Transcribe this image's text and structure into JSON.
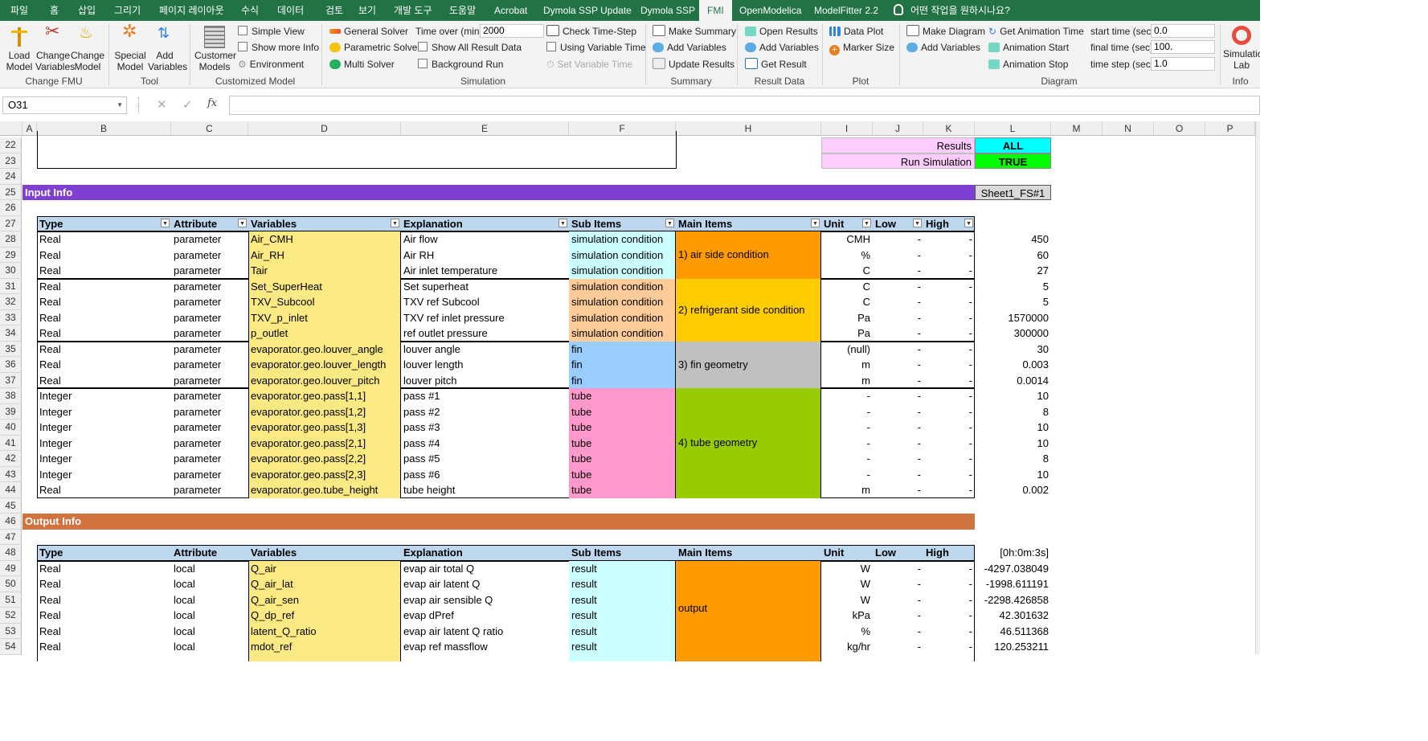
{
  "tabs": [
    "파일",
    "홈",
    "삽입",
    "그리기",
    "페이지 레이아웃",
    "수식",
    "데이터",
    "검토",
    "보기",
    "개발 도구",
    "도움말",
    "Acrobat",
    "Dymola SSP Update",
    "Dymola SSP",
    "FMI",
    "OpenModelica",
    "ModelFitter 2.2"
  ],
  "tell_me": "어떤 작업을 원하시나요?",
  "ribbon": {
    "change_fmu": {
      "load": "Load\nModel",
      "change_vars": "Change\nVariables",
      "change_model": "Change\nModel",
      "group": "Change FMU"
    },
    "tool": {
      "special": "Special\nModel",
      "add_vars": "Add\nVariables",
      "group": "Tool"
    },
    "customized": {
      "customer": "Customer\nModels",
      "simple_view": "Simple View",
      "show_more": "Show more Info",
      "environment": "Environment",
      "group": "Customized Model"
    },
    "simulation": {
      "general": "General Solver",
      "parametric": "Parametric Solver",
      "multi": "Multi Solver",
      "time_over_label": "Time over (min)",
      "time_over_value": "2000",
      "show_all": "Show All Result Data",
      "background": "Background Run",
      "check_time": "Check Time-Step",
      "using_var_time": "Using Variable Time",
      "set_var_time": "Set Variable Time",
      "group": "Simulation"
    },
    "summary": {
      "make": "Make Summary",
      "add_vars": "Add Variables",
      "update": "Update Results",
      "group": "Summary"
    },
    "result_data": {
      "open": "Open Results",
      "add_vars": "Add Variables",
      "get": "Get Result",
      "group": "Result Data"
    },
    "plot": {
      "data_plot": "Data Plot",
      "marker_size": "Marker Size",
      "group": "Plot"
    },
    "diagram": {
      "make": "Make Diagram",
      "add_vars": "Add Variables",
      "get_anim": "Get Animation Time",
      "anim_start": "Animation Start",
      "anim_stop": "Animation Stop",
      "start_label": "start time (sec)",
      "start_value": "0.0",
      "final_label": "final time (sec)",
      "final_value": "100.",
      "step_label": "time step (sec)",
      "step_value": "1.0",
      "group": "Diagram"
    },
    "info": {
      "simlab": "Simulation\nLab",
      "group": "Info"
    }
  },
  "formula": {
    "name_box": "O31",
    "value": ""
  },
  "columns": [
    "A",
    "B",
    "C",
    "D",
    "E",
    "F",
    "H",
    "I",
    "J",
    "K",
    "L",
    "M",
    "N",
    "O",
    "P"
  ],
  "rows": [
    "22",
    "23",
    "24",
    "25",
    "26",
    "27",
    "28",
    "29",
    "30",
    "31",
    "32",
    "33",
    "34",
    "35",
    "36",
    "37",
    "38",
    "39",
    "40",
    "41",
    "42",
    "43",
    "44",
    "45",
    "46",
    "47",
    "48",
    "49",
    "50",
    "51",
    "52",
    "53",
    "54"
  ],
  "status": {
    "results_label": "Results",
    "results_value": "ALL",
    "run_label": "Run Simulation",
    "run_value": "TRUE"
  },
  "input": {
    "section": "Input Info",
    "sheet_ref": "Sheet1_FS#1",
    "headers": [
      "Type",
      "Attribute",
      "Variables",
      "Explanation",
      "Sub Items",
      "Main Items",
      "Unit",
      "Low",
      "High"
    ],
    "rows": [
      {
        "type": "Real",
        "attr": "parameter",
        "var": "Air_CMH",
        "exp": "Air flow",
        "sub": "simulation condition",
        "unit": "CMH",
        "low": "-",
        "high": "-",
        "val": "450"
      },
      {
        "type": "Real",
        "attr": "parameter",
        "var": "Air_RH",
        "exp": "Air RH",
        "sub": "simulation condition",
        "unit": "%",
        "low": "-",
        "high": "-",
        "val": "60"
      },
      {
        "type": "Real",
        "attr": "parameter",
        "var": "Tair",
        "exp": "Air inlet temperature",
        "sub": "simulation condition",
        "unit": "C",
        "low": "-",
        "high": "-",
        "val": "27"
      },
      {
        "type": "Real",
        "attr": "parameter",
        "var": "Set_SuperHeat",
        "exp": "Set superheat",
        "sub": "simulation condition",
        "unit": "C",
        "low": "-",
        "high": "-",
        "val": "5"
      },
      {
        "type": "Real",
        "attr": "parameter",
        "var": "TXV_Subcool",
        "exp": "TXV ref Subcool",
        "sub": "simulation condition",
        "unit": "C",
        "low": "-",
        "high": "-",
        "val": "5"
      },
      {
        "type": "Real",
        "attr": "parameter",
        "var": "TXV_p_inlet",
        "exp": "TXV ref inlet pressure",
        "sub": "simulation condition",
        "unit": "Pa",
        "low": "-",
        "high": "-",
        "val": "1570000"
      },
      {
        "type": "Real",
        "attr": "parameter",
        "var": "p_outlet",
        "exp": "ref outlet pressure",
        "sub": "simulation condition",
        "unit": "Pa",
        "low": "-",
        "high": "-",
        "val": "300000"
      },
      {
        "type": "Real",
        "attr": "parameter",
        "var": "evaporator.geo.louver_angle",
        "exp": "louver angle",
        "sub": "fin",
        "unit": "(null)",
        "low": "-",
        "high": "-",
        "val": "30"
      },
      {
        "type": "Real",
        "attr": "parameter",
        "var": "evaporator.geo.louver_length",
        "exp": "louver length",
        "sub": "fin",
        "unit": "m",
        "low": "-",
        "high": "-",
        "val": "0.003"
      },
      {
        "type": "Real",
        "attr": "parameter",
        "var": "evaporator.geo.louver_pitch",
        "exp": "louver pitch",
        "sub": "fin",
        "unit": "m",
        "low": "-",
        "high": "-",
        "val": "0.0014"
      },
      {
        "type": "Integer",
        "attr": "parameter",
        "var": "evaporator.geo.pass[1,1]",
        "exp": "pass #1",
        "sub": "tube",
        "unit": "-",
        "low": "-",
        "high": "-",
        "val": "10"
      },
      {
        "type": "Integer",
        "attr": "parameter",
        "var": "evaporator.geo.pass[1,2]",
        "exp": "pass #2",
        "sub": "tube",
        "unit": "-",
        "low": "-",
        "high": "-",
        "val": "8"
      },
      {
        "type": "Integer",
        "attr": "parameter",
        "var": "evaporator.geo.pass[1,3]",
        "exp": "pass #3",
        "sub": "tube",
        "unit": "-",
        "low": "-",
        "high": "-",
        "val": "10"
      },
      {
        "type": "Integer",
        "attr": "parameter",
        "var": "evaporator.geo.pass[2,1]",
        "exp": "pass #4",
        "sub": "tube",
        "unit": "-",
        "low": "-",
        "high": "-",
        "val": "10"
      },
      {
        "type": "Integer",
        "attr": "parameter",
        "var": "evaporator.geo.pass[2,2]",
        "exp": "pass #5",
        "sub": "tube",
        "unit": "-",
        "low": "-",
        "high": "-",
        "val": "8"
      },
      {
        "type": "Integer",
        "attr": "parameter",
        "var": "evaporator.geo.pass[2,3]",
        "exp": "pass #6",
        "sub": "tube",
        "unit": "-",
        "low": "-",
        "high": "-",
        "val": "10"
      },
      {
        "type": "Real",
        "attr": "parameter",
        "var": "evaporator.geo.tube_height",
        "exp": "tube height",
        "sub": "tube",
        "unit": "m",
        "low": "-",
        "high": "-",
        "val": "0.002"
      }
    ],
    "groups": [
      {
        "label": "1) air side condition",
        "color": "#ff9a00",
        "sub_color": "#ccffff"
      },
      {
        "label": "2) refrigerant side condition",
        "color": "#ffcc00",
        "sub_color": "#ffcc99"
      },
      {
        "label": "3) fin geometry",
        "color": "#c0c0c0",
        "sub_color": "#99ccff"
      },
      {
        "label": "4) tube geometry",
        "color": "#99cc00",
        "sub_color": "#ff99cc"
      }
    ]
  },
  "output": {
    "section": "Output Info",
    "headers": [
      "Type",
      "Attribute",
      "Variables",
      "Explanation",
      "Sub Items",
      "Main Items",
      "Unit",
      "Low",
      "High"
    ],
    "time_header": "[0h:0m:3s]",
    "main_label": "output",
    "rows": [
      {
        "type": "Real",
        "attr": "local",
        "var": "Q_air",
        "exp": "evap air total Q",
        "sub": "result",
        "unit": "W",
        "low": "-",
        "high": "-",
        "val": "-4297.038049"
      },
      {
        "type": "Real",
        "attr": "local",
        "var": "Q_air_lat",
        "exp": "evap air latent Q",
        "sub": "result",
        "unit": "W",
        "low": "-",
        "high": "-",
        "val": "-1998.611191"
      },
      {
        "type": "Real",
        "attr": "local",
        "var": "Q_air_sen",
        "exp": "evap air sensible Q",
        "sub": "result",
        "unit": "W",
        "low": "-",
        "high": "-",
        "val": "-2298.426858"
      },
      {
        "type": "Real",
        "attr": "local",
        "var": "Q_dp_ref",
        "exp": "evap dPref",
        "sub": "result",
        "unit": "kPa",
        "low": "-",
        "high": "-",
        "val": "42.301632"
      },
      {
        "type": "Real",
        "attr": "local",
        "var": "latent_Q_ratio",
        "exp": "evap air latent Q ratio",
        "sub": "result",
        "unit": "%",
        "low": "-",
        "high": "-",
        "val": "46.511368"
      },
      {
        "type": "Real",
        "attr": "local",
        "var": "mdot_ref",
        "exp": "evap ref massflow",
        "sub": "result",
        "unit": "kg/hr",
        "low": "-",
        "high": "-",
        "val": "120.253211"
      }
    ]
  }
}
